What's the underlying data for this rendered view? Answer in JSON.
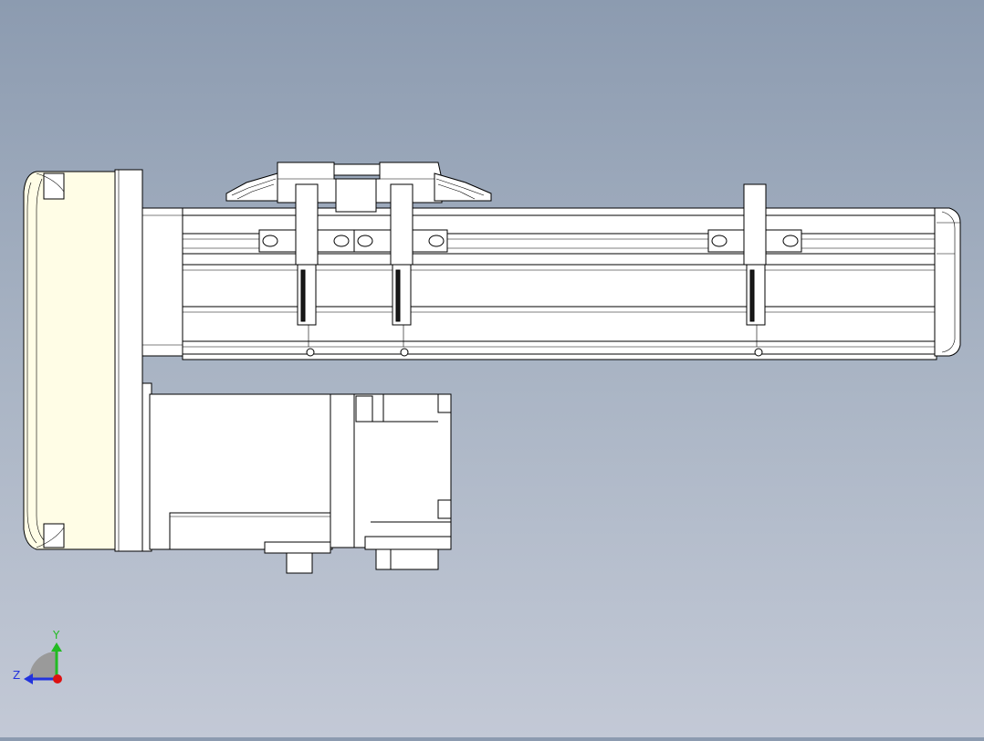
{
  "view": {
    "background_top": "#8c9bb0",
    "background_bottom": "#c3c9d6"
  },
  "triad": {
    "y_label": "Y",
    "z_label": "Z",
    "y_color": "#22bb22",
    "z_color": "#2233dd",
    "x_color": "#dd1111"
  }
}
